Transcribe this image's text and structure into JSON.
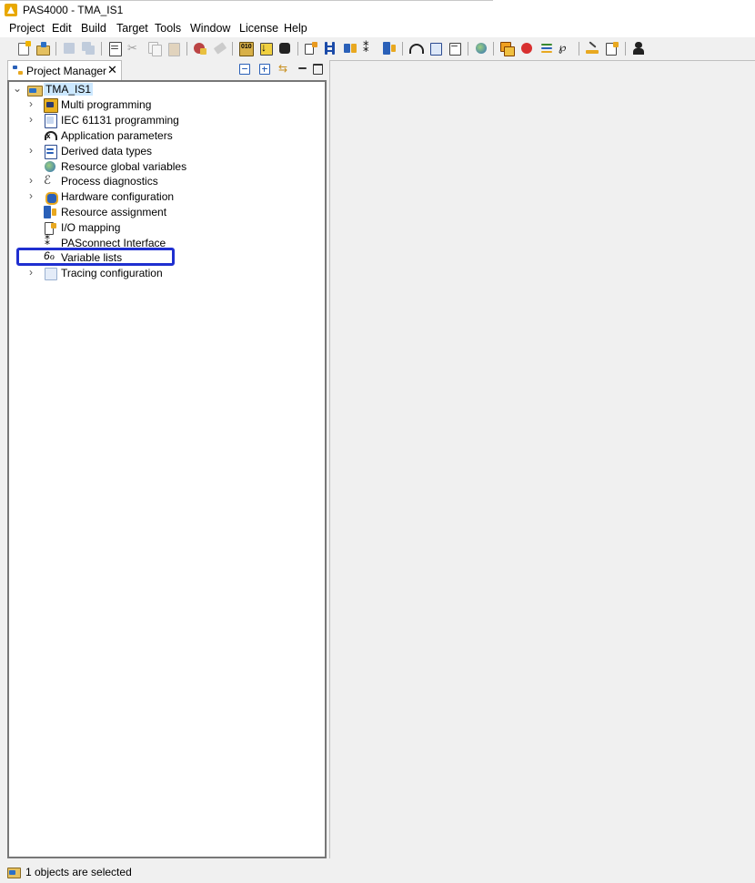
{
  "window": {
    "title": "PAS4000 - TMA_IS1"
  },
  "menu": [
    "Project",
    "Edit",
    "Build",
    "Target",
    "Tools",
    "Window",
    "License",
    "Help"
  ],
  "toolbar_icons": [
    "new-project-icon",
    "open-project-icon",
    "save-icon",
    "save-all-icon",
    "print-icon",
    "cut-icon",
    "copy-icon",
    "paste-icon",
    "verify-icon",
    "clean-icon",
    "compile-icon",
    "download-icon",
    "stop-icon",
    "connect-icon",
    "io-icon",
    "io-mapping-icon",
    "network-icon",
    "transfer-icon",
    "gauge-icon",
    "table-icon",
    "list-icon",
    "globe-icon",
    "windows-icon",
    "diagnostics-icon",
    "report-icon",
    "variable-list-icon",
    "edit-icon",
    "help-icon",
    "user-icon"
  ],
  "project_manager": {
    "tab_label": "Project Manager",
    "root": "TMA_IS1",
    "items": [
      {
        "label": "Multi programming",
        "expandable": true,
        "icon": "multi-programming-icon"
      },
      {
        "label": "IEC 61131 programming",
        "expandable": true,
        "icon": "iec-programming-icon"
      },
      {
        "label": "Application parameters",
        "expandable": false,
        "icon": "application-parameters-icon"
      },
      {
        "label": "Derived data types",
        "expandable": true,
        "icon": "derived-data-types-icon"
      },
      {
        "label": "Resource global variables",
        "expandable": false,
        "icon": "globe-icon"
      },
      {
        "label": "Process diagnostics",
        "expandable": true,
        "icon": "process-diagnostics-icon"
      },
      {
        "label": "Hardware configuration",
        "expandable": true,
        "icon": "hardware-configuration-icon"
      },
      {
        "label": "Resource assignment",
        "expandable": false,
        "icon": "resource-assignment-icon"
      },
      {
        "label": "I/O mapping",
        "expandable": false,
        "icon": "io-mapping-icon"
      },
      {
        "label": "PASconnect Interface",
        "expandable": false,
        "icon": "pasconnect-icon"
      },
      {
        "label": "Variable lists",
        "expandable": false,
        "icon": "variable-lists-icon"
      },
      {
        "label": "Tracing configuration",
        "expandable": true,
        "icon": "tracing-configuration-icon"
      }
    ]
  },
  "status": {
    "text": "1 objects are selected"
  }
}
